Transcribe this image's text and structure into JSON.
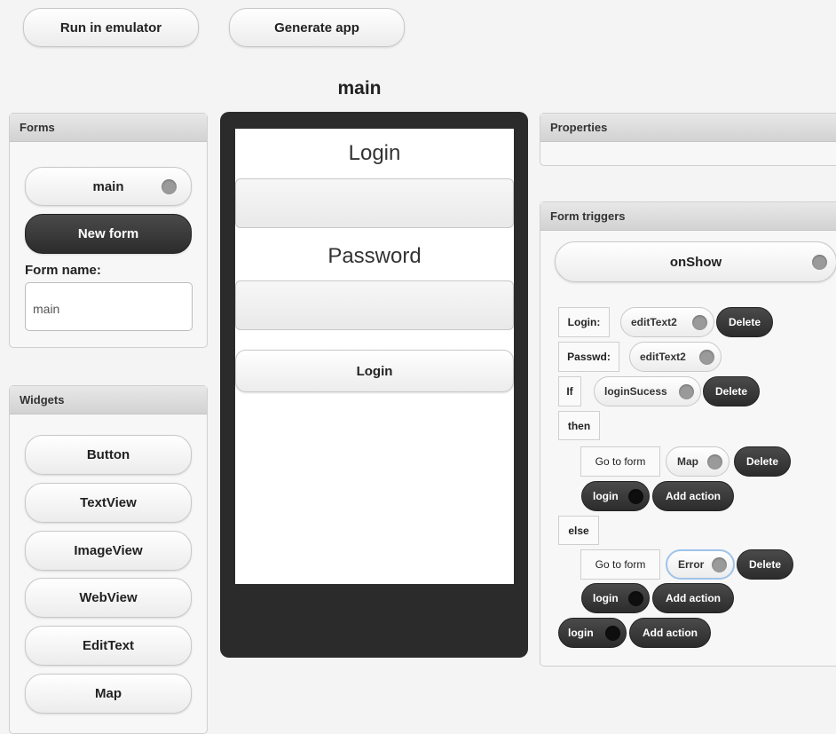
{
  "toolbar": {
    "run_label": "Run in emulator",
    "generate_label": "Generate app"
  },
  "canvas_title": "main",
  "forms_panel": {
    "header": "Forms",
    "forms": [
      {
        "label": "main"
      }
    ],
    "new_form_label": "New form",
    "form_name_label": "Form name:",
    "form_name_value": "main"
  },
  "widgets_panel": {
    "header": "Widgets",
    "items": [
      "Button",
      "TextView",
      "ImageView",
      "WebView",
      "EditText",
      "Map"
    ]
  },
  "phone": {
    "login_title": "Login",
    "password_title": "Password",
    "login_button": "Login"
  },
  "properties_panel": {
    "header": "Properties"
  },
  "triggers_panel": {
    "header": "Form triggers",
    "trigger": "onShow",
    "row1": {
      "label": "Login:",
      "value": "editText2",
      "delete": "Delete"
    },
    "row2": {
      "label": "Passwd:",
      "value": "editText2"
    },
    "row3": {
      "keyword": "If",
      "value": "loginSucess",
      "delete": "Delete"
    },
    "then_label": "then",
    "then_action": {
      "label": "Go to form",
      "value": "Map",
      "delete": "Delete",
      "event": "login",
      "add": "Add action"
    },
    "else_label": "else",
    "else_action": {
      "label": "Go to form",
      "value": "Error",
      "delete": "Delete",
      "event": "login",
      "add": "Add action"
    },
    "outer_action": {
      "event": "login",
      "add": "Add action"
    }
  },
  "icons": {
    "toggle": "circle-toggle-icon"
  }
}
